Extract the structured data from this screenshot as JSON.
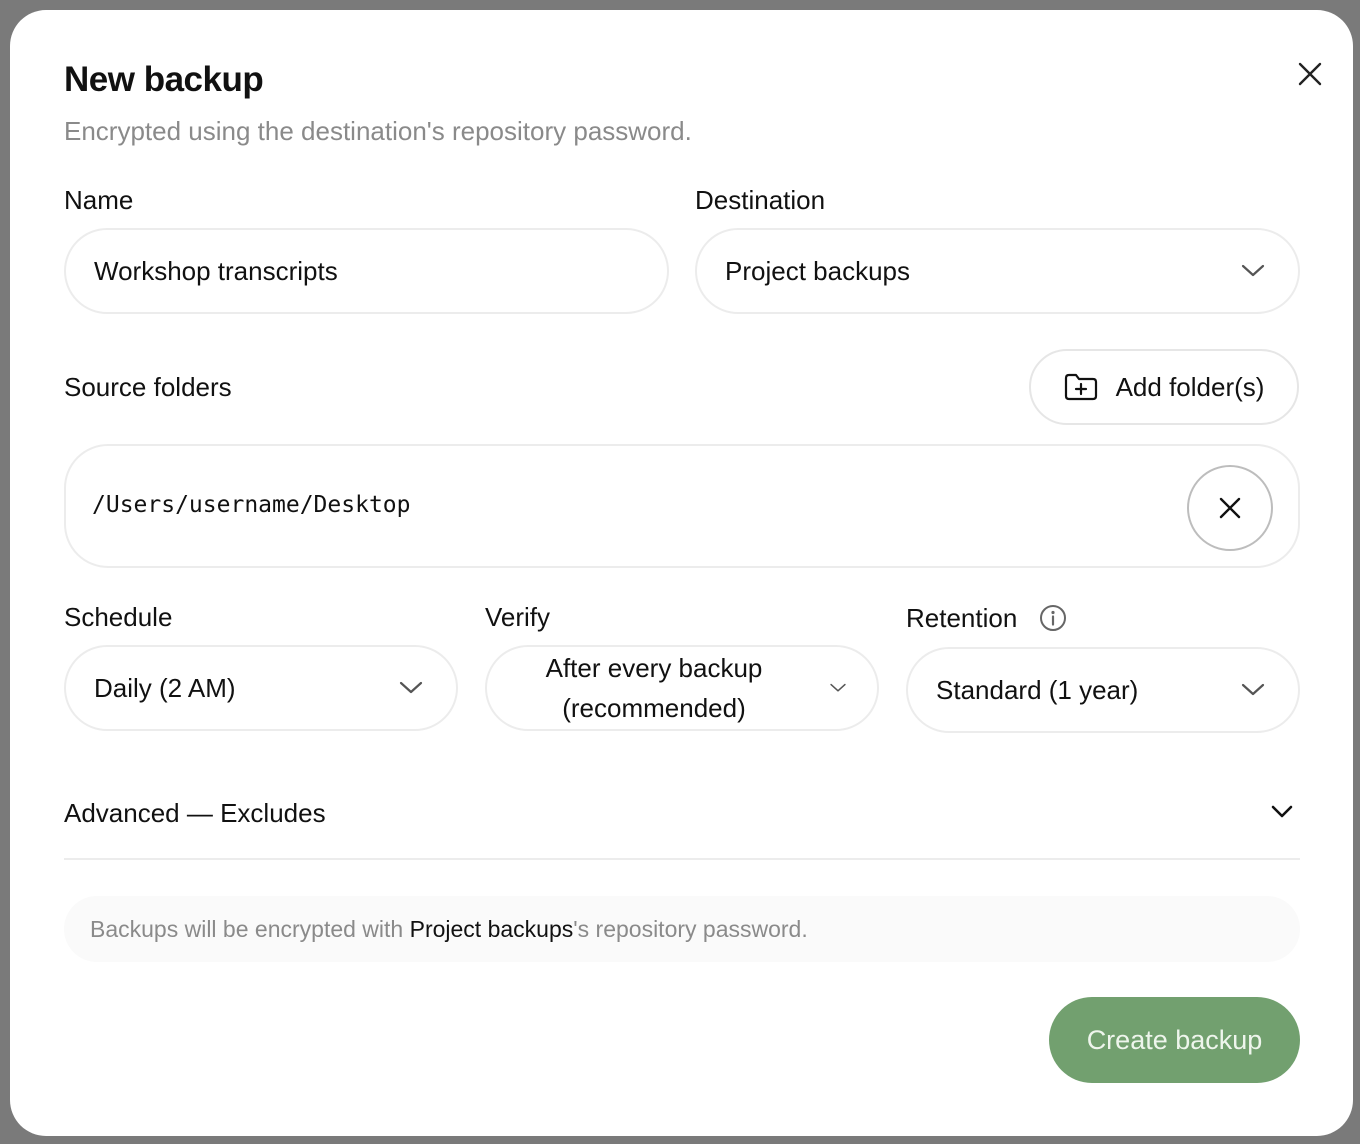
{
  "dialog": {
    "title": "New backup",
    "subtitle": "Encrypted using the destination's repository password.",
    "close_icon": "close-icon"
  },
  "name_field": {
    "label": "Name",
    "value": "Workshop transcripts"
  },
  "destination_field": {
    "label": "Destination",
    "value": "Project backups",
    "icon": "chevron-down-icon"
  },
  "source_folders": {
    "label": "Source folders",
    "add_button_label": "Add folder(s)",
    "add_icon": "folder-plus-icon",
    "items": [
      {
        "path": "/Users/username/Desktop",
        "remove_icon": "close-icon"
      }
    ]
  },
  "schedule_field": {
    "label": "Schedule",
    "value": "Daily (2 AM)"
  },
  "verify_field": {
    "label": "Verify",
    "value_line1": "After every backup",
    "value_line2": "(recommended)"
  },
  "retention_field": {
    "label": "Retention",
    "info_icon": "info-icon",
    "value": "Standard (1 year)"
  },
  "advanced": {
    "label": "Advanced — Excludes"
  },
  "note": {
    "prefix": "Backups will be encrypted with ",
    "destination": "Project backups",
    "suffix": "'s repository password."
  },
  "footer": {
    "create_label": "Create backup"
  },
  "colors": {
    "accent": "#72a06f",
    "muted_text": "#8a8a8a",
    "border": "#ececec"
  }
}
